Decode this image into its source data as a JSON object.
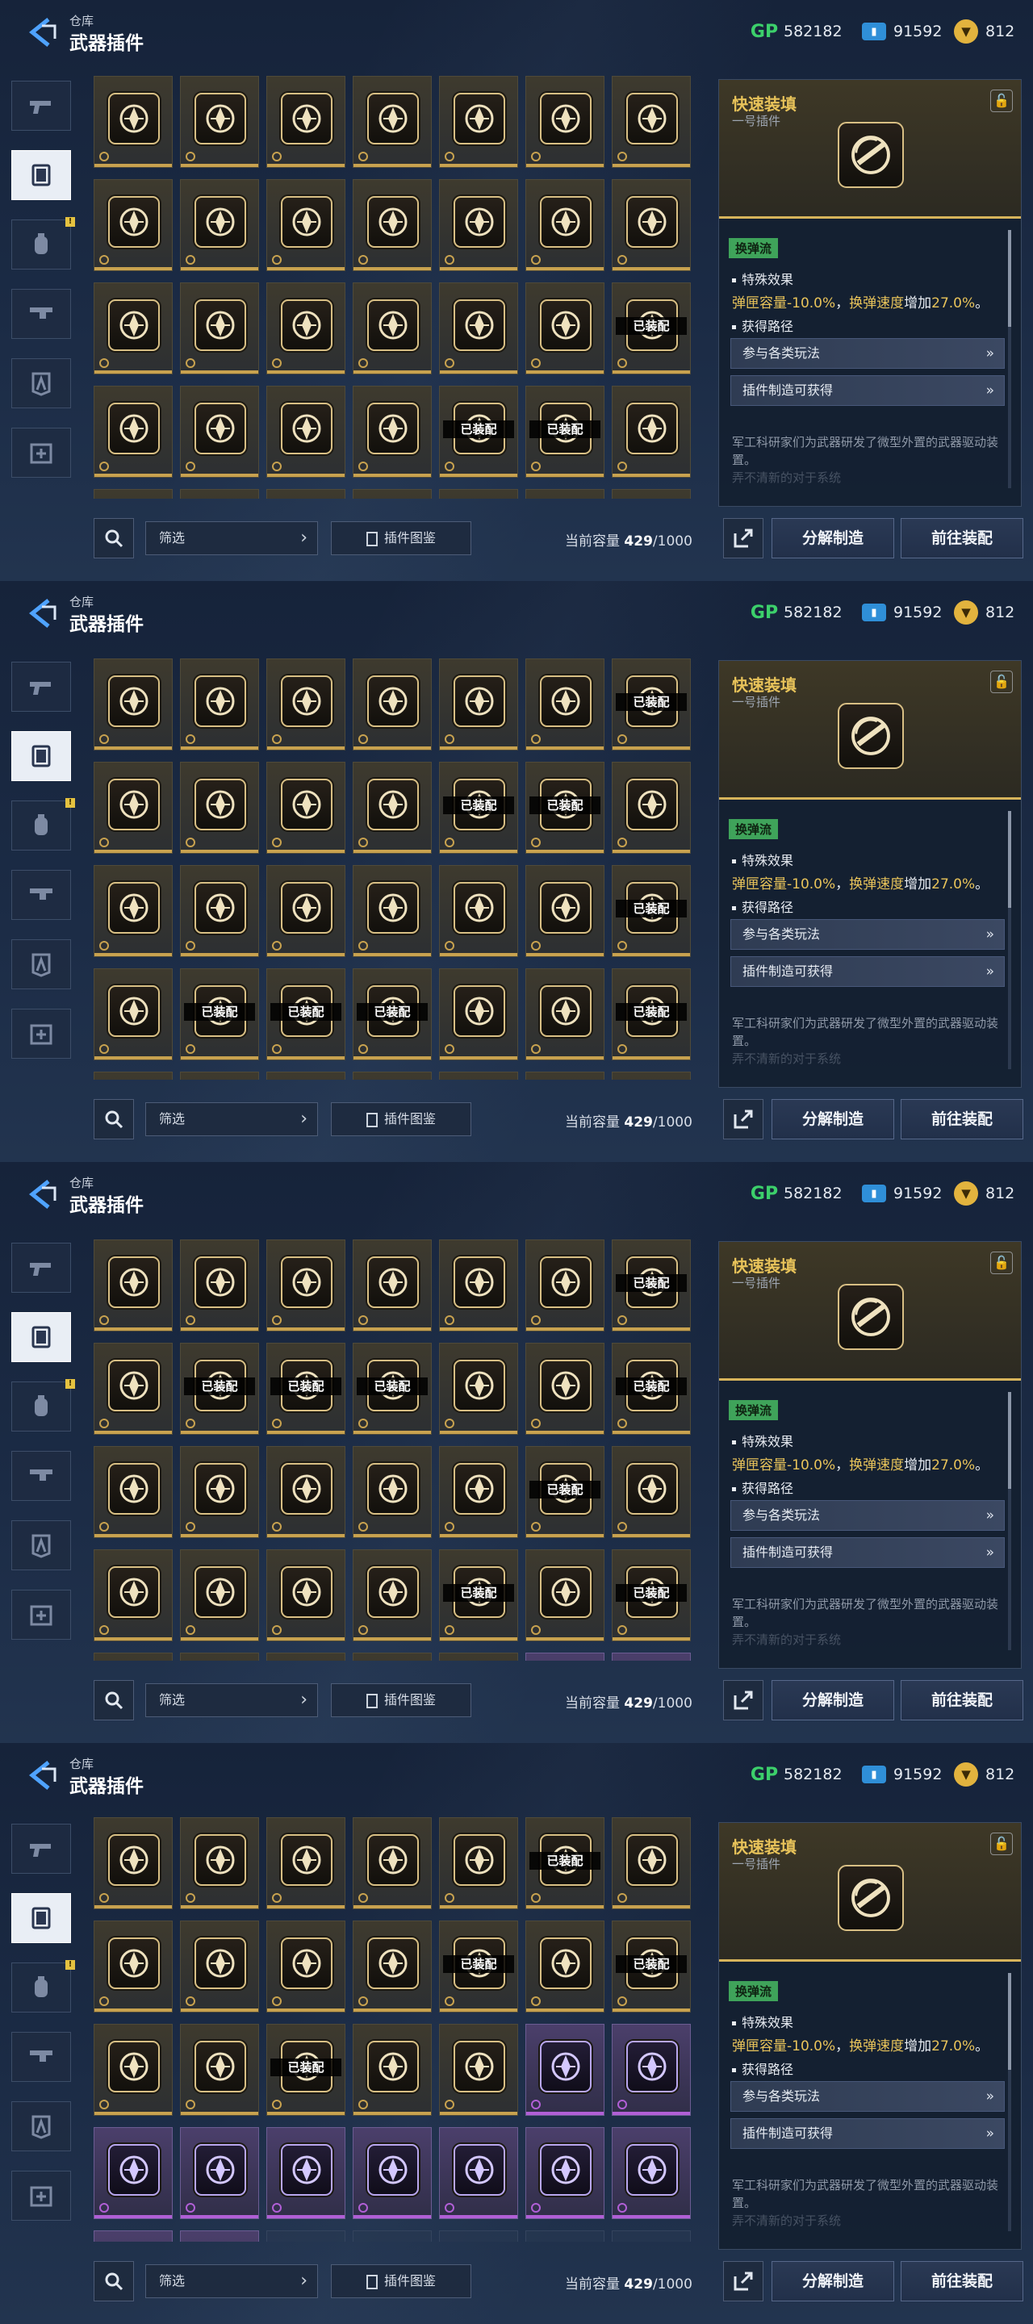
{
  "header": {
    "breadcrumb": "仓库",
    "title": "武器插件",
    "currencies": [
      {
        "icon": "gp-icon",
        "label": "GP",
        "value": "582182"
      },
      {
        "icon": "ticket-icon",
        "value": "91592"
      },
      {
        "icon": "token-icon",
        "value": "812"
      }
    ]
  },
  "sidebar": [
    {
      "icon": "pistol-icon",
      "selected": false,
      "badge": ""
    },
    {
      "icon": "plugin-chip-icon",
      "selected": true,
      "badge": ""
    },
    {
      "icon": "grenade-icon",
      "selected": false,
      "badge": "!"
    },
    {
      "icon": "gun-module-icon",
      "selected": false,
      "badge": ""
    },
    {
      "icon": "armor-icon",
      "selected": false,
      "badge": ""
    },
    {
      "icon": "medkit-icon",
      "selected": false,
      "badge": ""
    }
  ],
  "detail": {
    "name": "快速装填",
    "subtitle": "一号插件",
    "icon": "reload-plugin-icon",
    "lock_icon": "lock-icon",
    "tag": "换弹流",
    "effect_heading": "特殊效果",
    "effect_part1": "弹匣容量-10.0%",
    "effect_sep": "，",
    "effect_part2": "换弹速度",
    "effect_part3": "增加",
    "effect_part4": "27.0%",
    "effect_end": "。",
    "route_heading": "获得路径",
    "routes": [
      "参与各类玩法",
      "插件制造可获得"
    ],
    "description": "军工科研家们为武器研发了微型外置的武器驱动装置。",
    "description_faded": "弄不清新的对于系统"
  },
  "bottom": {
    "filter_label": "筛选",
    "atlas_label": "插件图鉴",
    "capacity_label": "当前容量",
    "capacity_used": "429",
    "capacity_total": "/1000",
    "dismantle_label": "分解制造",
    "equip_label": "前往装配"
  },
  "equipped_text": "已装配",
  "colors": {
    "gold": "#d8bf84",
    "purple": "#b8a6ee",
    "tag_green": "#3fa35a",
    "highlight": "#e8c35a"
  },
  "grid": [
    [
      "gold",
      "arrow-burst-icon",
      0
    ],
    [
      "gold",
      "hexagon-bolt-icon",
      0
    ],
    [
      "gold",
      "flame-orb-icon",
      0
    ],
    [
      "gold",
      "flame-icon",
      0
    ],
    [
      "gold",
      "slash-orb-icon",
      0
    ],
    [
      "gold",
      "cycle-arrows-icon",
      0
    ],
    [
      "gold",
      "demon-crown-icon",
      0
    ],
    [
      "gold",
      "demon-mask-icon",
      0
    ],
    [
      "gold",
      "broken-ring-icon",
      0
    ],
    [
      "gold",
      "broken-ring-icon",
      0
    ],
    [
      "gold",
      "broken-ring-icon",
      0
    ],
    [
      "gold",
      "ogre-head-icon",
      0
    ],
    [
      "gold",
      "ogre-head-icon",
      0
    ],
    [
      "gold",
      "ogre-head-icon",
      0
    ],
    [
      "gold",
      "horned-skull-icon",
      0
    ],
    [
      "gold",
      "horned-skull-icon",
      0
    ],
    [
      "gold",
      "horned-skull-icon",
      0
    ],
    [
      "gold",
      "crossed-swords-icon",
      0
    ],
    [
      "gold",
      "shield-slash-icon",
      0
    ],
    [
      "gold",
      "rocket-orbit-icon",
      0
    ],
    [
      "gold",
      "feather-slash-icon",
      1
    ],
    [
      "gold",
      "claw-slash-icon",
      0
    ],
    [
      "gold",
      "target-diamond-icon",
      0
    ],
    [
      "gold",
      "trident-wing-icon",
      0
    ],
    [
      "gold",
      "star-burst-icon",
      0
    ],
    [
      "gold",
      "star-burst-icon",
      1
    ],
    [
      "gold",
      "star-burst-icon",
      1
    ],
    [
      "gold",
      "star-burst-icon",
      0
    ],
    [
      "gold",
      "stars-cluster-icon",
      0
    ],
    [
      "gold",
      "stars-cluster-icon",
      0
    ],
    [
      "gold",
      "stars-cluster-icon",
      0
    ],
    [
      "gold",
      "x-octagon-icon",
      0
    ],
    [
      "gold",
      "x-octagon-icon",
      0
    ],
    [
      "gold",
      "x-octagon-icon",
      0
    ],
    [
      "gold",
      "x-octagon-icon",
      1
    ],
    [
      "gold",
      "x-octagon-icon",
      0
    ],
    [
      "gold",
      "x-octagon-icon",
      1
    ],
    [
      "gold",
      "x-octagon-icon",
      1
    ],
    [
      "gold",
      "skull-octagon-icon",
      1
    ],
    [
      "gold",
      "skull-octagon-icon",
      0
    ],
    [
      "gold",
      "skull-octagon-icon",
      0
    ],
    [
      "gold",
      "skull-octagon-icon",
      1
    ],
    [
      "gold",
      "bullet-circle-icon",
      0
    ],
    [
      "gold",
      "bullet-circle-icon",
      0
    ],
    [
      "gold",
      "bullet-circle-icon",
      0
    ],
    [
      "gold",
      "crown-triangle-icon",
      0
    ],
    [
      "gold",
      "crown-triangle-icon",
      0
    ],
    [
      "gold",
      "crown-triangle-icon",
      1
    ],
    [
      "gold",
      "wolf-head-icon",
      0
    ],
    [
      "gold",
      "wolf-head-icon",
      0
    ],
    [
      "gold",
      "lotus-shield-icon",
      0
    ],
    [
      "gold",
      "lotus-shield-icon",
      0
    ],
    [
      "gold",
      "lotus-shield-icon",
      0
    ],
    [
      "gold",
      "lotus-shield-icon",
      1
    ],
    [
      "gold",
      "chevron-stack-icon",
      0
    ],
    [
      "gold",
      "chevron-stack-icon",
      1
    ],
    [
      "gold",
      "dollar-ring-icon",
      0
    ],
    [
      "gold",
      "dollar-ring-icon",
      0
    ],
    [
      "gold",
      "dollar-ring-icon",
      1
    ],
    [
      "gold",
      "rifle-stack-icon",
      0
    ],
    [
      "gold",
      "rifle-stack-icon",
      0
    ],
    [
      "purple",
      "boots-wing-icon",
      0
    ],
    [
      "purple",
      "slash-stripes-icon",
      0
    ],
    [
      "purple",
      "pillars-orb-icon",
      0
    ],
    [
      "purple",
      "dice-orb-icon",
      0
    ],
    [
      "purple",
      "cube-orb-icon",
      0
    ],
    [
      "purple",
      "wing-bolt-icon",
      0
    ],
    [
      "purple",
      "w-wave-icon",
      0
    ],
    [
      "purple",
      "gun-turret-icon",
      0
    ],
    [
      "purple",
      "arrow-volley-icon",
      0
    ],
    [
      "purple",
      "crystal-burst-icon",
      0
    ],
    [
      "purple",
      "hex-slash-icon",
      0
    ],
    [
      "empty",
      "",
      0
    ],
    [
      "empty",
      "",
      0
    ],
    [
      "empty",
      "",
      0
    ],
    [
      "empty",
      "",
      0
    ],
    [
      "empty",
      "",
      0
    ]
  ]
}
